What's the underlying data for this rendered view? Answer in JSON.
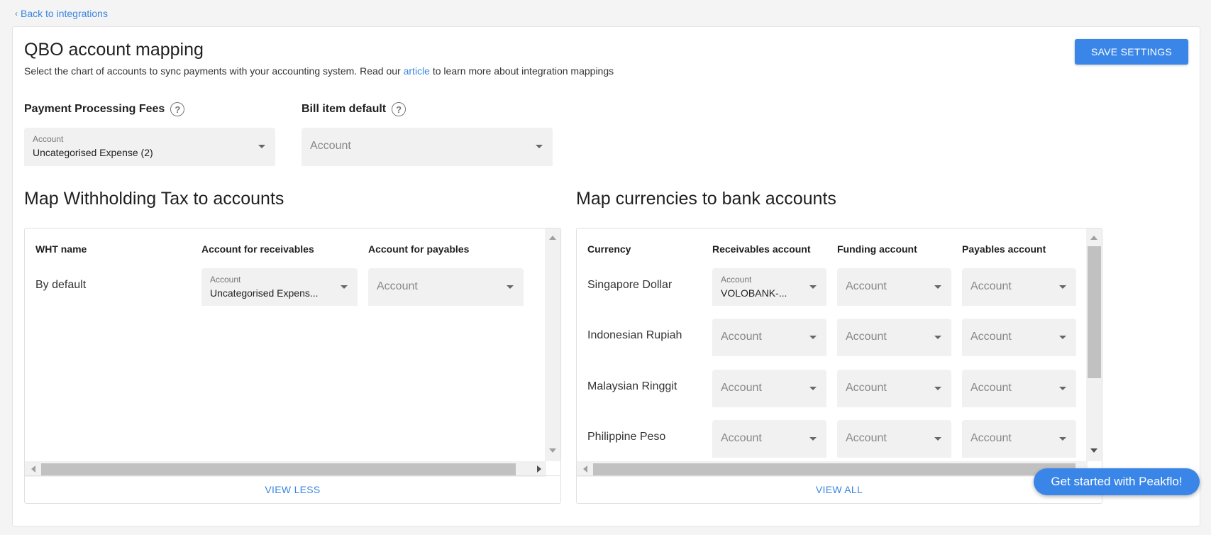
{
  "nav": {
    "back_label": "Back to integrations"
  },
  "header": {
    "title": "QBO account mapping",
    "subtitle_before": "Select the chart of accounts to sync payments with your accounting system. Read our ",
    "subtitle_link": "article",
    "subtitle_after": " to learn more about integration mappings",
    "save_label": "SAVE SETTINGS"
  },
  "defaults": {
    "processing_fees": {
      "label": "Payment Processing Fees",
      "field_label": "Account",
      "value": "Uncategorised Expense (2)"
    },
    "bill_item": {
      "label": "Bill item default",
      "placeholder": "Account"
    }
  },
  "wht": {
    "title": "Map Withholding Tax to accounts",
    "columns": [
      "WHT name",
      "Account for receivables",
      "Account for payables"
    ],
    "rows": [
      {
        "name": "By default",
        "receivables_label": "Account",
        "receivables_value": "Uncategorised Expens...",
        "payables_placeholder": "Account"
      }
    ],
    "footer_label": "VIEW LESS"
  },
  "currencies": {
    "title": "Map currencies to bank accounts",
    "columns": [
      "Currency",
      "Receivables account",
      "Funding account",
      "Payables account"
    ],
    "rows": [
      {
        "name": "Singapore Dollar",
        "receivables_label": "Account",
        "receivables_value": "VOLOBANK-...",
        "funding": "Account",
        "payables": "Account"
      },
      {
        "name": "Indonesian Rupiah",
        "receivables": "Account",
        "funding": "Account",
        "payables": "Account"
      },
      {
        "name": "Malaysian Ringgit",
        "receivables": "Account",
        "funding": "Account",
        "payables": "Account"
      },
      {
        "name": "Philippine Peso",
        "receivables": "Account",
        "funding": "Account",
        "payables": "Account"
      }
    ],
    "footer_label": "VIEW ALL"
  },
  "help": {
    "icon": "?"
  },
  "cta": {
    "label": "Get started with Peakflo!"
  }
}
